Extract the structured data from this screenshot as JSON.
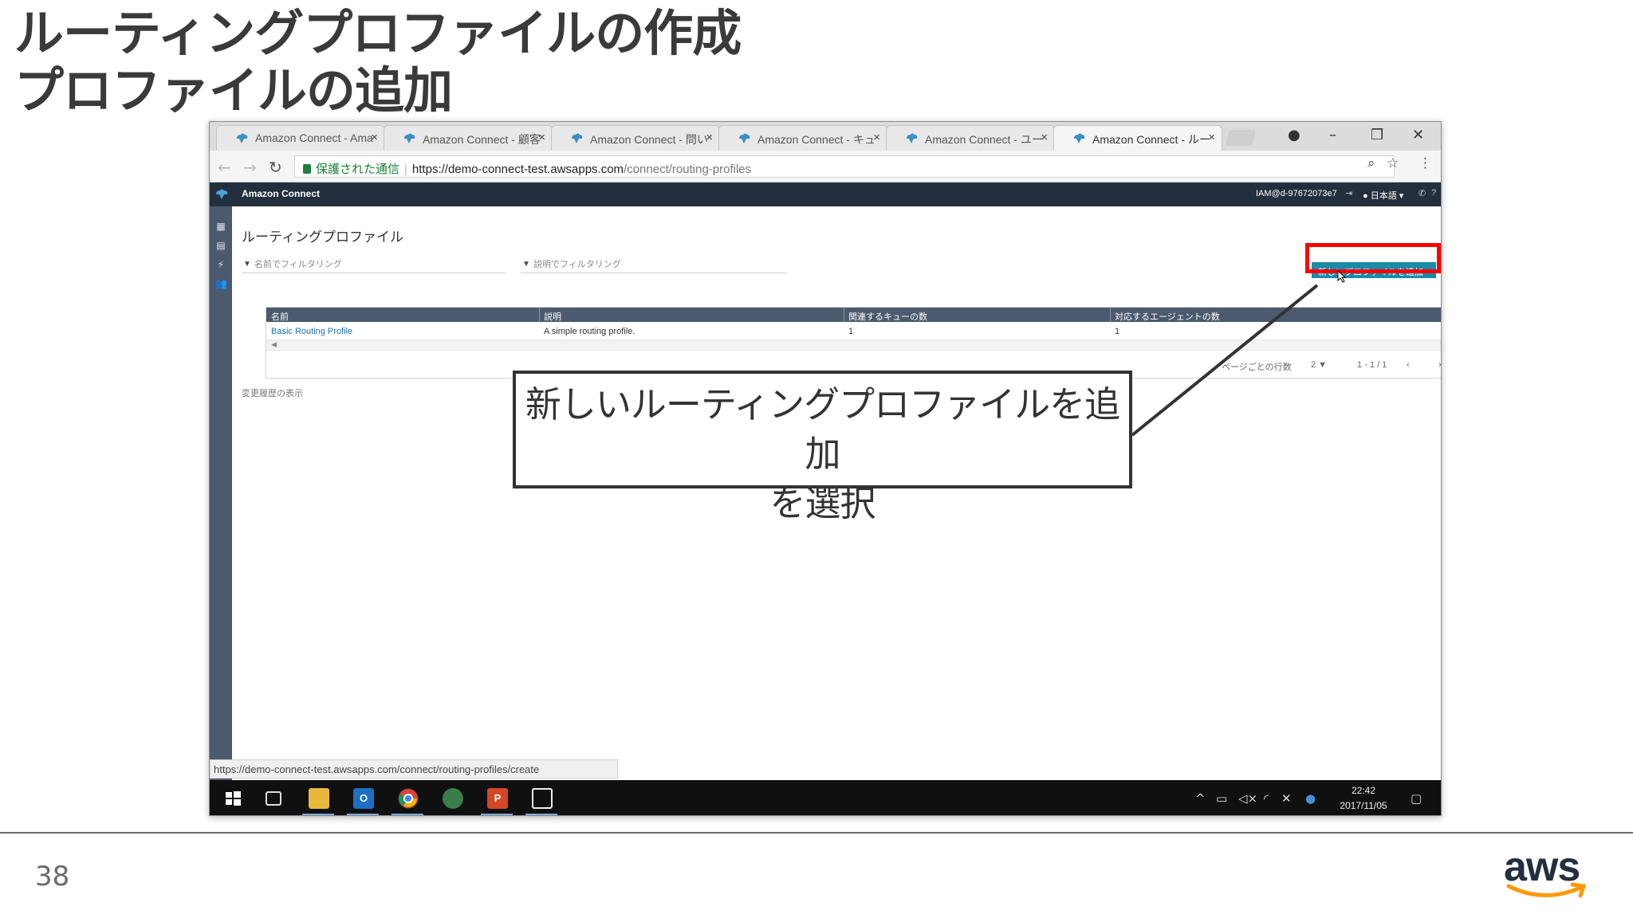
{
  "slide": {
    "title_line1": "ルーティングプロファイルの作成",
    "title_line2": "プロファイルの追加",
    "page_number": "38",
    "logo_text": "aws"
  },
  "browser": {
    "tabs": [
      {
        "label": "Amazon Connect - Ama",
        "active": false
      },
      {
        "label": "Amazon Connect - 顧客",
        "active": false
      },
      {
        "label": "Amazon Connect - 問い",
        "active": false
      },
      {
        "label": "Amazon Connect - キュ",
        "active": false
      },
      {
        "label": "Amazon Connect - ユー",
        "active": false
      },
      {
        "label": "Amazon Connect - ルー",
        "active": true
      }
    ],
    "tab_close": "×",
    "secure_label": "保護された通信",
    "url_host": "https://demo-connect-test.awsapps.com",
    "url_path": "/connect/routing-profiles",
    "status_url": "https://demo-connect-test.awsapps.com/connect/routing-profiles/create"
  },
  "app": {
    "name": "Amazon Connect",
    "user": "IAM@d-97672073e7",
    "language": "日本語",
    "page_title": "ルーティングプロファイル",
    "filter_name_placeholder": "名前でフィルタリング",
    "filter_desc_placeholder": "説明でフィルタリング",
    "add_button_label": "新しいプロファイルを追加",
    "table": {
      "headers": [
        "名前",
        "説明",
        "関連するキューの数",
        "対応するエージェントの数"
      ],
      "rows": [
        [
          "Basic Routing Profile",
          "A simple routing profile.",
          "1",
          "1"
        ]
      ]
    },
    "pager": {
      "rows_per_page_label": "ページごとの行数",
      "rows_per_page": "2 ▼",
      "range": "1 - 1 / 1",
      "prev": "‹",
      "next": "›"
    },
    "history_link": "変更履歴の表示"
  },
  "taskbar": {
    "time": "22:42",
    "date": "2017/11/05"
  },
  "callout": {
    "line1": "新しいルーティングプロファイルを追加",
    "line2": "を選択"
  },
  "colors": {
    "app_header": "#232f3e",
    "nav_sidebar": "#4b5a6e",
    "button": "#1a8ba8",
    "highlight": "#ff0000"
  }
}
